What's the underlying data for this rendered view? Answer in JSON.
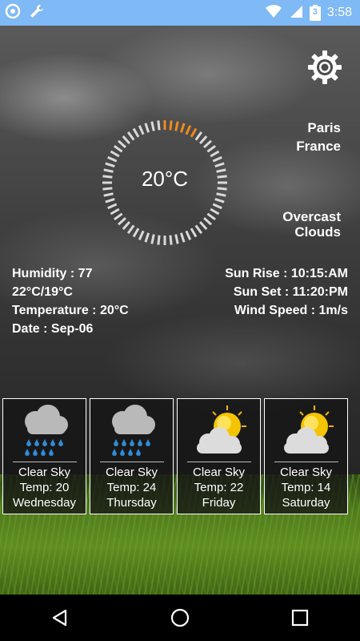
{
  "status_bar": {
    "time": "3:58",
    "battery_level": "3",
    "icons": [
      "notification-app-icon",
      "wrench-icon",
      "wifi-icon",
      "signal-icon",
      "battery-icon"
    ]
  },
  "settings": {
    "icon": "gear-icon"
  },
  "location": {
    "city": "Paris",
    "country": "France"
  },
  "condition": "Overcast\nClouds",
  "current_temp": "20°C",
  "dial_highlight_fraction": 0.1,
  "stats_left": [
    "Humidity : 77",
    "22°C/19°C",
    "Temperature : 20°C",
    "Date : Sep-06"
  ],
  "stats_right": [
    "Sun Rise : 10:15:AM",
    "Sun Set : 11:20:PM",
    "Wind Speed : 1m/s"
  ],
  "forecast": [
    {
      "icon": "rain-cloud-icon",
      "sky": "Clear Sky",
      "temp": "Temp: 20",
      "day": "Wednesday"
    },
    {
      "icon": "rain-cloud-icon",
      "sky": "Clear Sky",
      "temp": "Temp: 24",
      "day": "Thursday"
    },
    {
      "icon": "sun-cloud-icon",
      "sky": "Clear Sky",
      "temp": "Temp: 22",
      "day": "Friday"
    },
    {
      "icon": "sun-cloud-icon",
      "sky": "Clear Sky",
      "temp": "Temp: 14",
      "day": "Saturday"
    }
  ],
  "navbar": {
    "icons": [
      "back-icon",
      "home-icon",
      "recents-icon"
    ]
  },
  "colors": {
    "status_bar": "#7fb9f6",
    "dial_accent": "#f08a1e",
    "dial_ticks": "#d9d9d9"
  }
}
